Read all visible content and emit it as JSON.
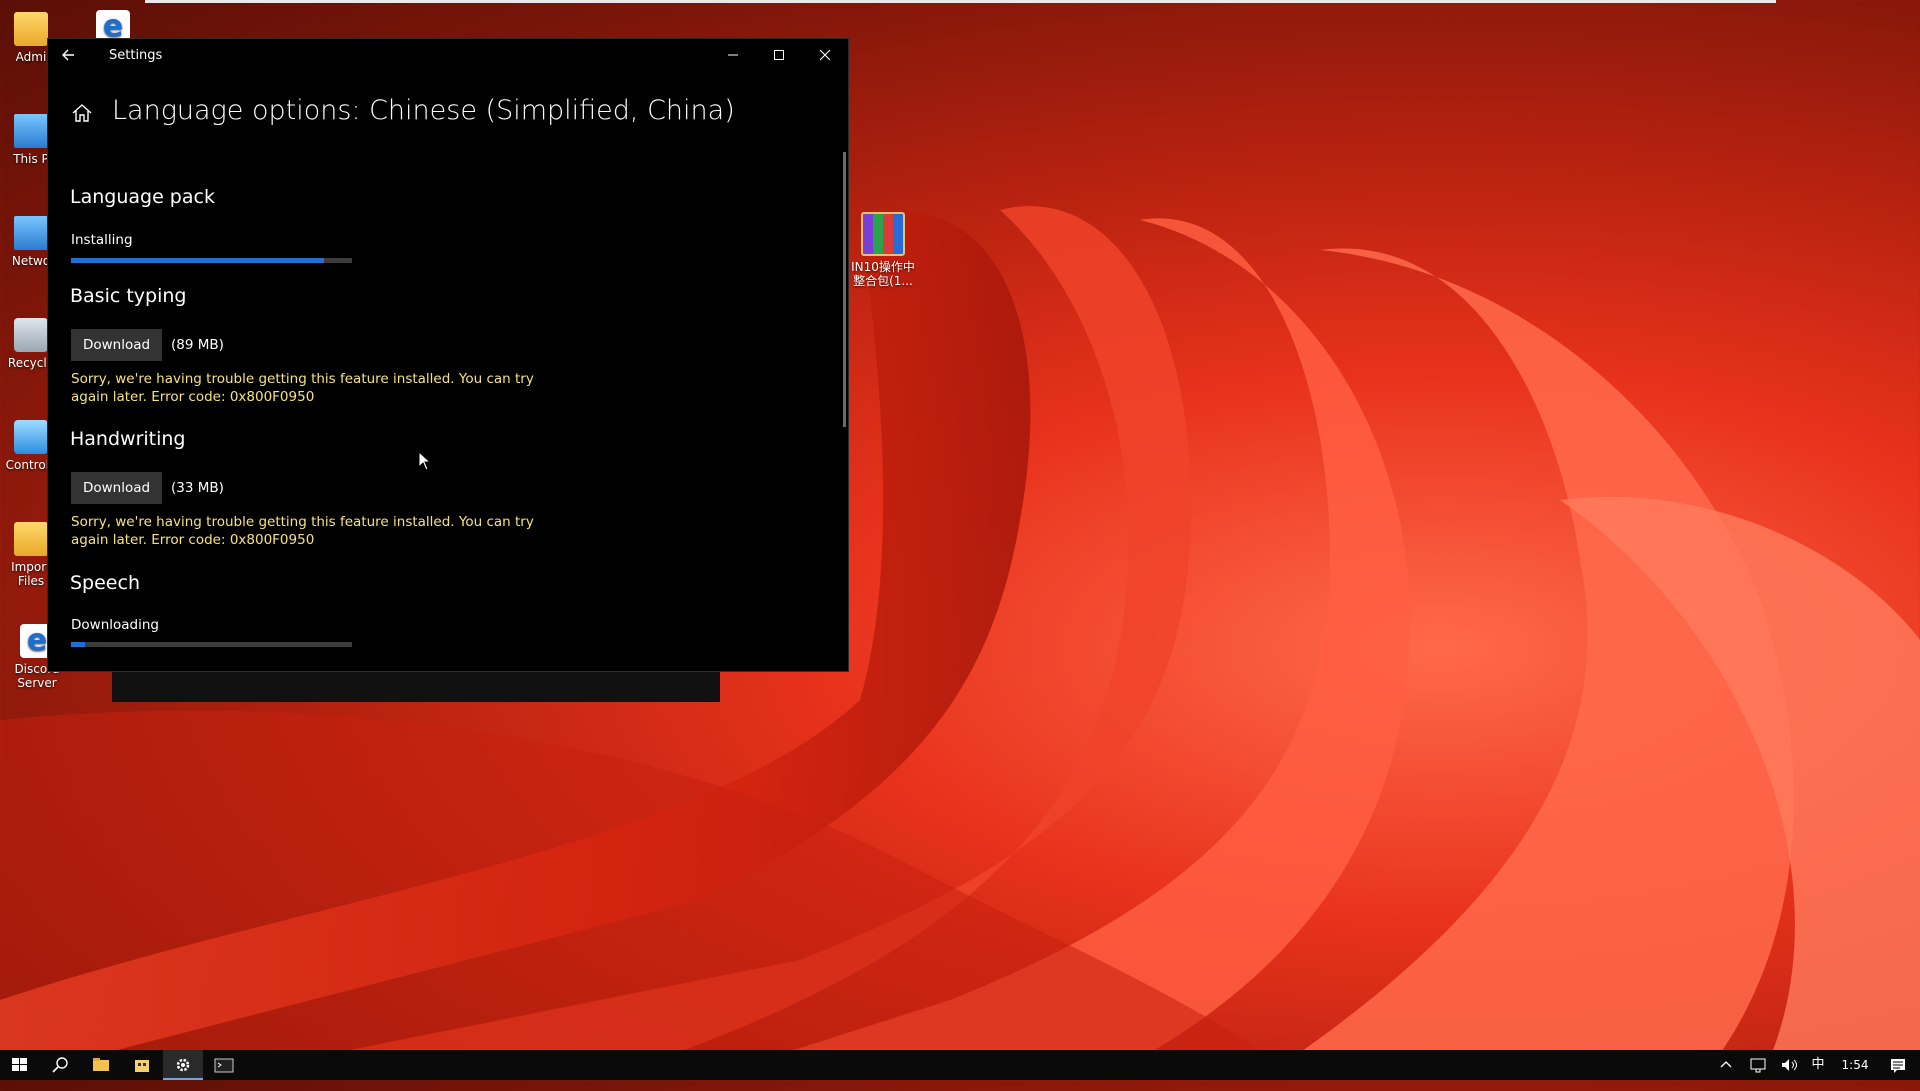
{
  "desktop": {
    "icons": [
      {
        "label": "Admi",
        "icon": "folder-icon"
      },
      {
        "label": "",
        "icon": "edge-icon"
      },
      {
        "label": "This P",
        "icon": "this-pc-icon"
      },
      {
        "label": "Netwo",
        "icon": "network-icon"
      },
      {
        "label": "Recycle",
        "icon": "recycle-bin-icon"
      },
      {
        "label": "Control I",
        "icon": "control-panel-icon"
      },
      {
        "label": "Import",
        "label2": "Files",
        "icon": "folder-icon"
      },
      {
        "label": "Discord",
        "label2": "Server",
        "icon": "edge-icon"
      }
    ],
    "rar": {
      "line1": "IN10操作中",
      "line2": "整合包(1..."
    }
  },
  "settings": {
    "title": "Settings",
    "page_title": "Language options: Chinese (Simplified, China)",
    "sections": {
      "language_pack": {
        "heading": "Language pack",
        "status": "Installing",
        "progress": 0.9
      },
      "basic_typing": {
        "heading": "Basic typing",
        "button": "Download",
        "size": "(89 MB)",
        "error_line1": "Sorry, we're having trouble getting this feature installed. You can try",
        "error_line2": "again later. Error code: 0x800F0950"
      },
      "handwriting": {
        "heading": "Handwriting",
        "button": "Download",
        "size": "(33 MB)",
        "error_line1": "Sorry, we're having trouble getting this feature installed. You can try",
        "error_line2": "again later. Error code: 0x800F0950"
      },
      "speech": {
        "heading": "Speech",
        "status": "Downloading",
        "progress": 0.05
      }
    }
  },
  "taskbar": {
    "items": [
      "start-icon",
      "search-icon",
      "file-explorer-icon",
      "store-icon",
      "settings-icon",
      "terminal-icon"
    ],
    "active": "settings-icon",
    "tray": {
      "ime": "中",
      "time": "1:54"
    }
  },
  "colors": {
    "accent": "#1f6fd6",
    "error": "#f6e27e",
    "window_bg": "#000000"
  }
}
